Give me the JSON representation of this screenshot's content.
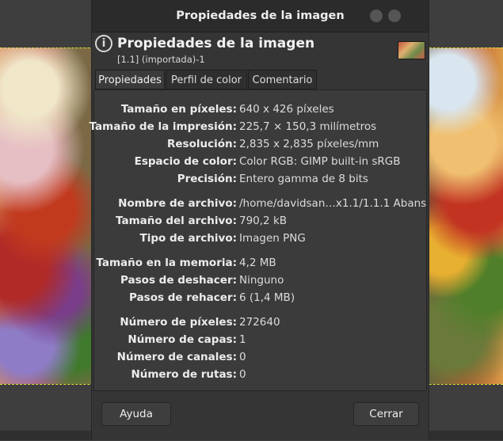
{
  "window": {
    "title": "Propiedades de la imagen"
  },
  "header": {
    "title": "Propiedades de la imagen",
    "subtitle": "[1.1] (importada)-1"
  },
  "tabs": [
    {
      "label": "Propiedades",
      "active": true
    },
    {
      "label": "Perfil de color",
      "active": false
    },
    {
      "label": "Comentario",
      "active": false
    }
  ],
  "properties": [
    {
      "label": "Tamaño en píxeles:",
      "value": "640 x 426 píxeles"
    },
    {
      "label": "Tamaño de la impresión:",
      "value": "225,7 × 150,3 milímetros"
    },
    {
      "label": "Resolución:",
      "value": "2,835 x 2,835 píxeles/mm"
    },
    {
      "label": "Espacio de color:",
      "value": "Color RGB: GIMP built-in sRGB"
    },
    {
      "label": "Precisión:",
      "value": "Entero gamma de 8 bits"
    },
    {
      "label": "Nombre de archivo:",
      "value": "/home/davidsan…x1.1/1.1.1 Abans"
    },
    {
      "label": "Tamaño del archivo:",
      "value": "790,2 kB"
    },
    {
      "label": "Tipo de archivo:",
      "value": "Imagen PNG"
    },
    {
      "label": "Tamaño en la memoria:",
      "value": "4,2 MB"
    },
    {
      "label": "Pasos de deshacer:",
      "value": "Ninguno"
    },
    {
      "label": "Pasos de rehacer:",
      "value": "6 (1,4 MB)"
    },
    {
      "label": "Número de píxeles:",
      "value": "272640"
    },
    {
      "label": "Número de capas:",
      "value": "1"
    },
    {
      "label": "Número de canales:",
      "value": "0"
    },
    {
      "label": "Número de rutas:",
      "value": "0"
    }
  ],
  "buttons": {
    "help": "Ayuda",
    "close": "Cerrar"
  },
  "icons": {
    "header": "info-icon",
    "thumbnail": "image-thumbnail"
  },
  "colors": {
    "dialog_bg": "#353535",
    "panel_bg": "#3b3b3b",
    "titlebar_bg": "#2b2b2b",
    "text": "#ececec"
  }
}
